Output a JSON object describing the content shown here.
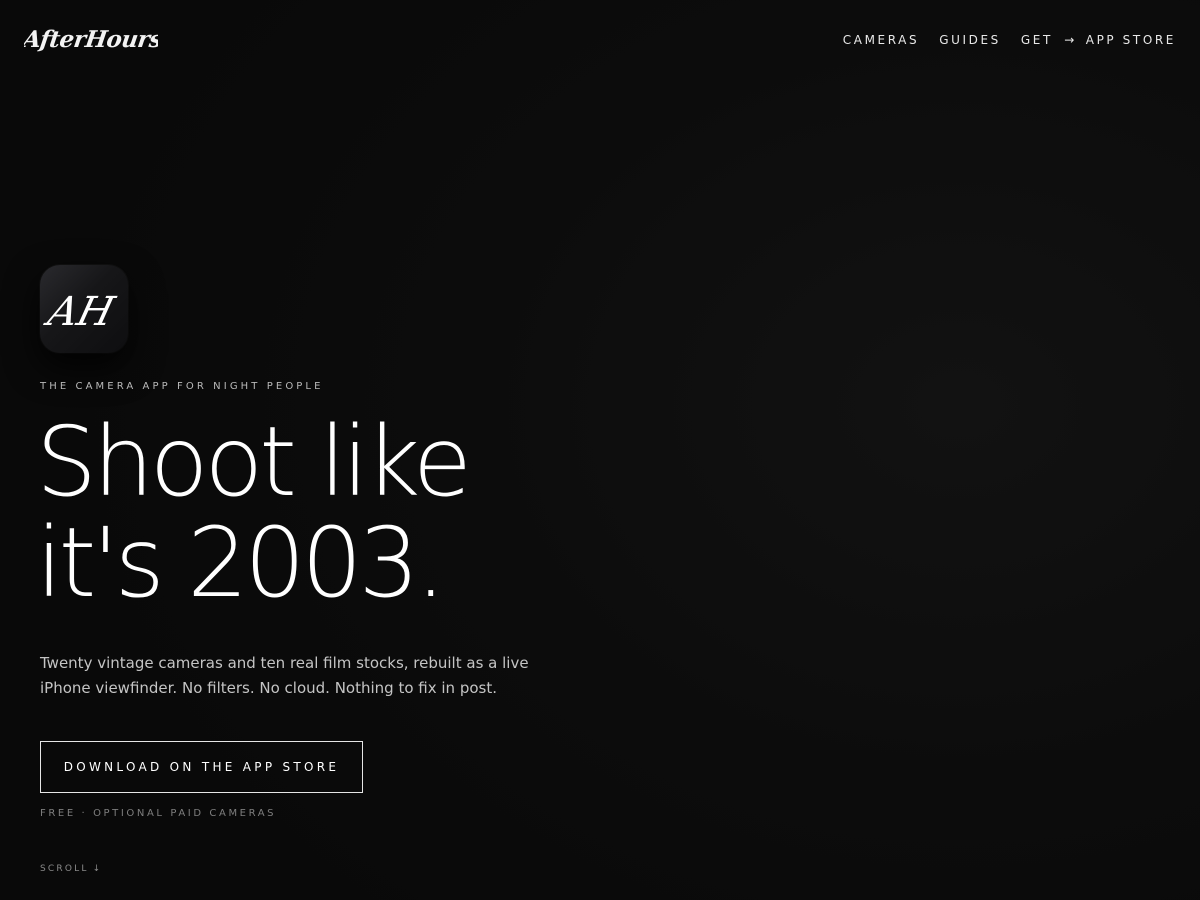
{
  "brand": {
    "logo_text": "AfterHours",
    "app_icon_monogram": "AH"
  },
  "nav": {
    "items": [
      {
        "label": "CAMERAS"
      },
      {
        "label": "GUIDES"
      }
    ],
    "get": {
      "prefix": "GET",
      "arrow": "→",
      "label": "APP STORE"
    }
  },
  "hero": {
    "tagline": "THE CAMERA APP FOR NIGHT PEOPLE",
    "headline_line1": "Shoot like",
    "headline_line2": "it's 2003.",
    "subtext_line1": "Twenty vintage cameras and ten real film stocks, rebuilt as a live",
    "subtext_line2": "iPhone viewfinder. No filters. No cloud. Nothing to fix in post.",
    "cta_label": "DOWNLOAD ON THE APP STORE",
    "pricing_note": "FREE · OPTIONAL PAID CAMERAS",
    "scroll_label": "SCROLL",
    "scroll_arrow": "↓"
  },
  "colors": {
    "background": "#0b0b0b",
    "text": "#ffffff",
    "muted": "#7e7e7e"
  },
  "icons": [
    "arrow-right-icon",
    "arrow-down-icon",
    "app-icon"
  ]
}
